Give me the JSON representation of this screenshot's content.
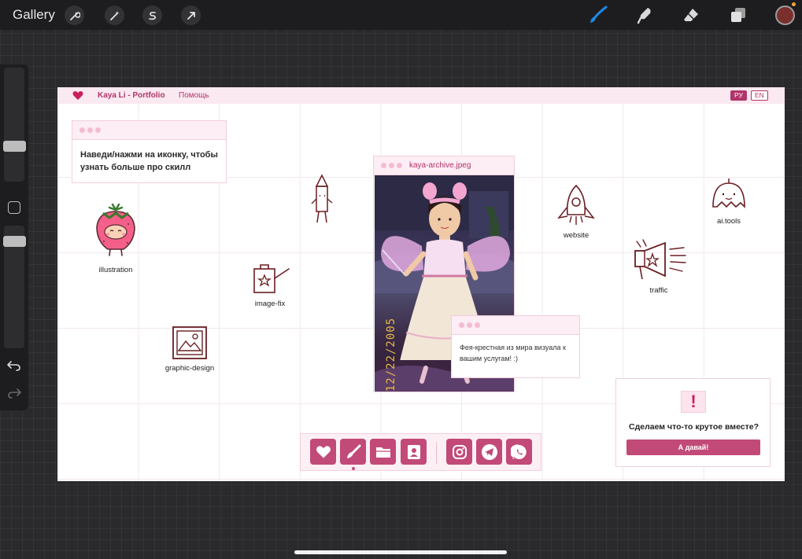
{
  "app": {
    "gallery_label": "Gallery",
    "tools_left": [
      "wrench-icon",
      "magic-wand-icon",
      "selection-s-icon",
      "transform-arrow-icon"
    ],
    "tools_right": [
      "brush-icon",
      "smudge-icon",
      "eraser-icon",
      "layers-icon"
    ],
    "active_color": "#7a2f2c",
    "accent": "#1e88e5"
  },
  "site": {
    "brand": "Kaya Li - Portfolio",
    "help": "Помощь",
    "lang_ru": "РУ",
    "lang_en": "EN",
    "accent": "#c24a78",
    "hint": "Наведи/нажми на иконку, чтобы узнать больше про скилл",
    "photo_title": "kaya-archive.jpeg",
    "photo_date": "12/22/2005",
    "fairy_text": "Фея-крестная из мира визуала к вашим услугам! :)",
    "skills": {
      "illustration": "illustration",
      "image_fix": "image-fix",
      "graphic_design": "graphic-design",
      "website": "website",
      "traffic": "traffic",
      "ai_tools": "ai.tools"
    },
    "cta": {
      "mark": "!",
      "text": "Сделаем что-то крутое вместе?",
      "button": "А давай!"
    },
    "dock": [
      "heart-icon",
      "brush-icon",
      "folder-icon",
      "contact-card-icon",
      "instagram-icon",
      "telegram-icon",
      "whatsapp-icon"
    ]
  }
}
